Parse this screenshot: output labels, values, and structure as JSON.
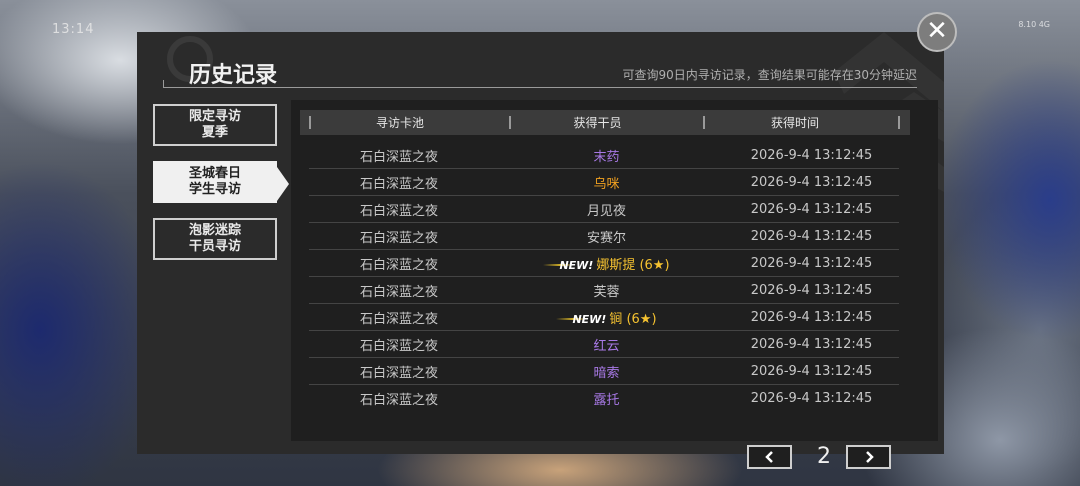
{
  "status": {
    "time": "13:14",
    "signal": "8.10 4G"
  },
  "header": {
    "title": "历史记录",
    "subtitle": "可查询90日内寻访记录，查询结果可能存在30分钟延迟"
  },
  "sidebar": {
    "tabs": [
      {
        "line1": "限定寻访",
        "line2": "夏季",
        "active": false
      },
      {
        "line1": "圣城春日",
        "line2": "学生寻访",
        "active": true
      },
      {
        "line1": "泡影迷踪",
        "line2": "干员寻访",
        "active": false
      }
    ]
  },
  "table": {
    "columns": [
      "寻访卡池",
      "获得干员",
      "获得时间"
    ],
    "new_label": "NEW!",
    "rows": [
      {
        "pool": "石白深蓝之夜",
        "operator": "末药",
        "color": "#a879e6",
        "is_new": false,
        "time": "2026-9-4 13:12:45"
      },
      {
        "pool": "石白深蓝之夜",
        "operator": "乌咪",
        "color": "#f0a020",
        "is_new": false,
        "time": "2026-9-4 13:12:45"
      },
      {
        "pool": "石白深蓝之夜",
        "operator": "月见夜",
        "color": "#c8c8c8",
        "is_new": false,
        "time": "2026-9-4 13:12:45"
      },
      {
        "pool": "石白深蓝之夜",
        "operator": "安赛尔",
        "color": "#c8c8c8",
        "is_new": false,
        "time": "2026-9-4 13:12:45"
      },
      {
        "pool": "石白深蓝之夜",
        "operator": "娜斯提 (6★)",
        "color": "#f5c230",
        "is_new": true,
        "time": "2026-9-4 13:12:45"
      },
      {
        "pool": "石白深蓝之夜",
        "operator": "芙蓉",
        "color": "#c8c8c8",
        "is_new": false,
        "time": "2026-9-4 13:12:45"
      },
      {
        "pool": "石白深蓝之夜",
        "operator": "锏 (6★)",
        "color": "#f5c230",
        "is_new": true,
        "time": "2026-9-4 13:12:45"
      },
      {
        "pool": "石白深蓝之夜",
        "operator": "红云",
        "color": "#a879e6",
        "is_new": false,
        "time": "2026-9-4 13:12:45"
      },
      {
        "pool": "石白深蓝之夜",
        "operator": "暗索",
        "color": "#a879e6",
        "is_new": false,
        "time": "2026-9-4 13:12:45"
      },
      {
        "pool": "石白深蓝之夜",
        "operator": "露托",
        "color": "#a879e6",
        "is_new": false,
        "time": "2026-9-4 13:12:45"
      }
    ]
  },
  "pager": {
    "page": "2",
    "prev_icon": "chevron-left-icon",
    "next_icon": "chevron-right-icon"
  },
  "close": {
    "icon": "close-icon"
  }
}
